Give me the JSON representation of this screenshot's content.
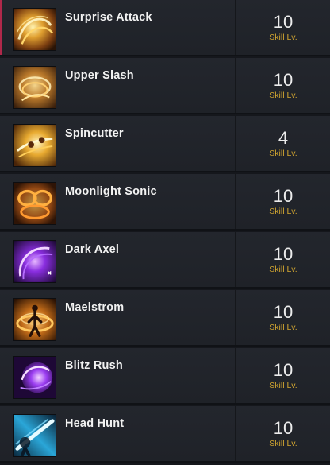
{
  "skills": [
    {
      "name": "Surprise Attack",
      "level": "10",
      "level_label": "Skill Lv.",
      "icon": "swirl-blade-icon",
      "theme": "gold"
    },
    {
      "name": "Upper Slash",
      "level": "10",
      "level_label": "Skill Lv.",
      "icon": "upward-slash-icon",
      "theme": "gold"
    },
    {
      "name": "Spincutter",
      "level": "4",
      "level_label": "Skill Lv.",
      "icon": "spinning-dash-icon",
      "theme": "gold"
    },
    {
      "name": "Moonlight Sonic",
      "level": "10",
      "level_label": "Skill Lv.",
      "icon": "twin-rings-icon",
      "theme": "gold"
    },
    {
      "name": "Dark Axel",
      "level": "10",
      "level_label": "Skill Lv.",
      "icon": "dark-vortex-icon",
      "theme": "purple"
    },
    {
      "name": "Maelstrom",
      "level": "10",
      "level_label": "Skill Lv.",
      "icon": "whirlwind-figure-icon",
      "theme": "gold"
    },
    {
      "name": "Blitz Rush",
      "level": "10",
      "level_label": "Skill Lv.",
      "icon": "purple-orb-icon",
      "theme": "purple"
    },
    {
      "name": "Head Hunt",
      "level": "10",
      "level_label": "Skill Lv.",
      "icon": "piercing-beam-icon",
      "theme": "cyan"
    }
  ],
  "colors": {
    "background": "#15171c",
    "row": "#23262d",
    "name_text": "#f2f2f2",
    "level_text": "#ececec",
    "level_label": "#d2a630",
    "selected_accent": "#b0284a"
  }
}
